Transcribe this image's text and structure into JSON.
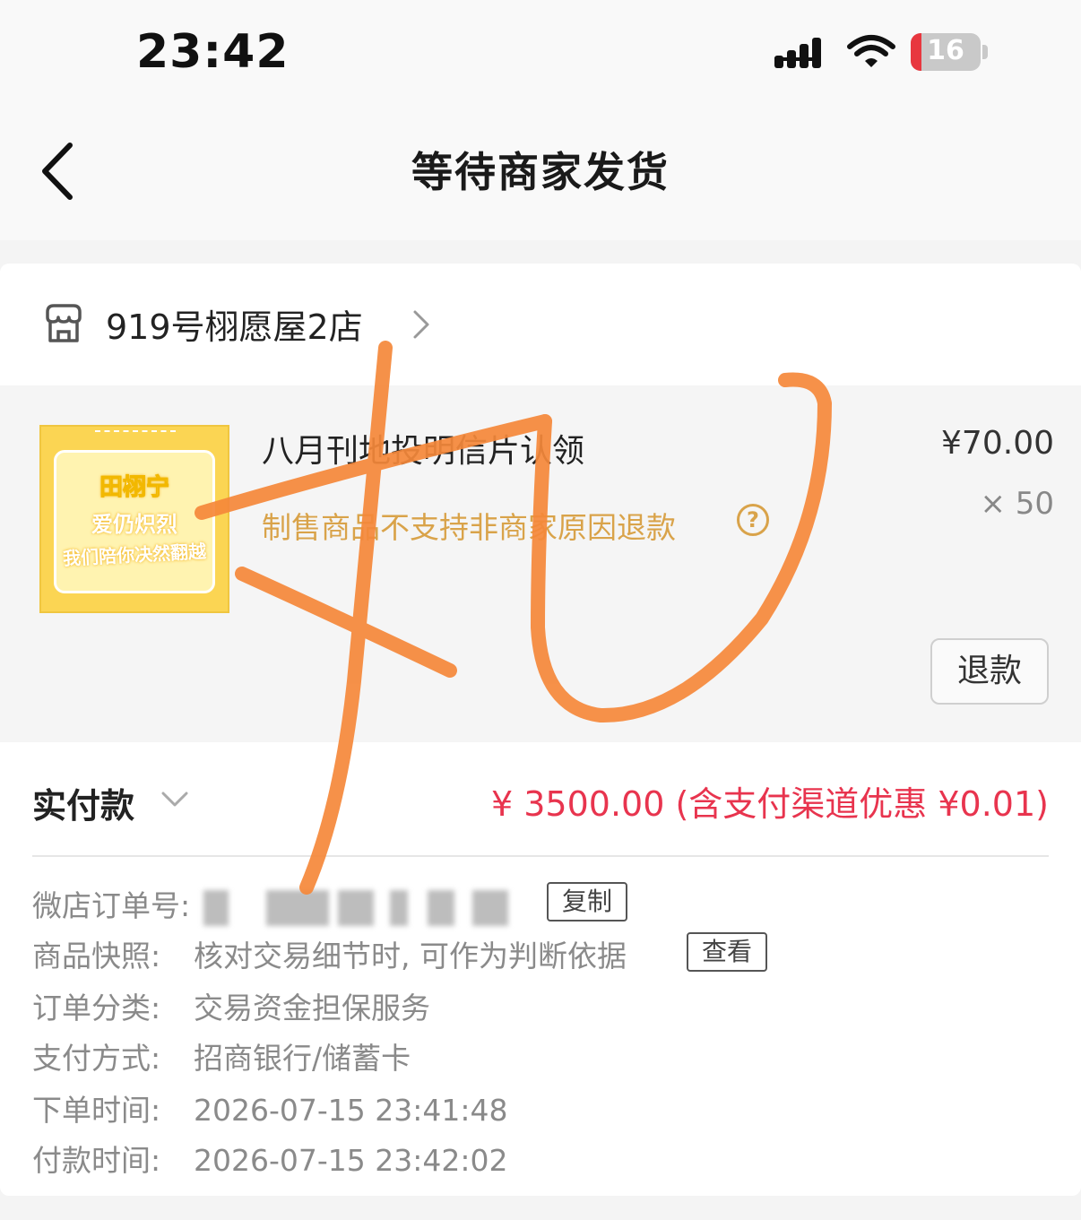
{
  "status_bar": {
    "time": "23:42",
    "battery": "16",
    "icons": [
      "cellular-signal-icon",
      "wifi-icon",
      "battery-icon"
    ]
  },
  "nav": {
    "title": "等待商家发货",
    "back_icon": "chevron-left-icon"
  },
  "shop": {
    "name": "919号栩愿屋2店",
    "icon": "store-icon",
    "chevron": "chevron-right-icon"
  },
  "product": {
    "title": "八月刊地投明信片认领",
    "note": "制售商品不支持非商家原因退款",
    "note_icon": "question-circle-icon",
    "price": "¥70.00",
    "quantity": "× 50",
    "refund_label": "退款",
    "thumbnail": {
      "line1": "田栩宁",
      "line2": "爱仍炽烈",
      "line3": "我们陪你决然翻越",
      "bg": "#fbd553"
    }
  },
  "payment": {
    "label": "实付款",
    "amount": "¥ 3500.00 (含支付渠道优惠 ¥0.01)",
    "amount_color": "#e8344e"
  },
  "details": [
    {
      "key": "微店订单号:",
      "value": "",
      "button": "复制"
    },
    {
      "key": "商品快照:",
      "value": "核对交易细节时, 可作为判断依据",
      "button": "查看"
    },
    {
      "key": "订单分类:",
      "value": "交易资金担保服务"
    },
    {
      "key": "支付方式:",
      "value": "招商银行/储蓄卡"
    },
    {
      "key": "下单时间:",
      "value": "2026-07-15 23:41:48"
    },
    {
      "key": "付款时间:",
      "value": "2026-07-15 23:42:02"
    }
  ],
  "colors": {
    "accent_red": "#e8344e",
    "note_orange": "#d9a34a",
    "scribble": "#f5883a"
  }
}
